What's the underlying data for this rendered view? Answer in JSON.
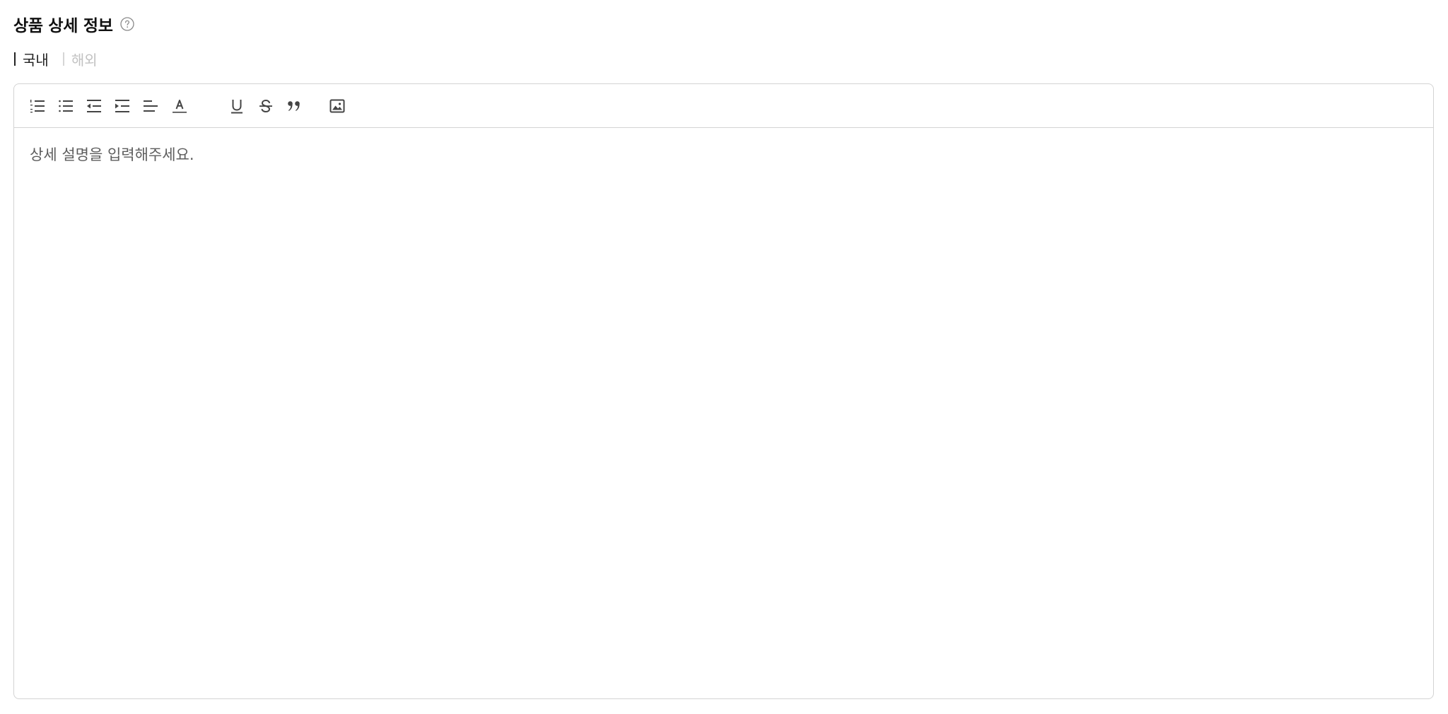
{
  "section": {
    "title": "상품 상세 정보",
    "help_icon": "question-circle-icon"
  },
  "tabs": [
    {
      "label": "국내",
      "active": true
    },
    {
      "label": "해외",
      "active": false
    }
  ],
  "toolbar": {
    "tools": [
      {
        "name": "ordered-list",
        "icon": "ordered-list-icon"
      },
      {
        "name": "bullet-list",
        "icon": "bullet-list-icon"
      },
      {
        "name": "outdent",
        "icon": "outdent-icon"
      },
      {
        "name": "indent",
        "icon": "indent-icon"
      },
      {
        "name": "align-left",
        "icon": "align-left-icon"
      },
      {
        "name": "text-color",
        "icon": "text-color-icon"
      },
      {
        "name": "underline",
        "icon": "underline-icon"
      },
      {
        "name": "strikethrough",
        "icon": "strikethrough-icon"
      },
      {
        "name": "blockquote",
        "icon": "quote-icon"
      },
      {
        "name": "image",
        "icon": "image-icon"
      }
    ]
  },
  "editor": {
    "placeholder": "상세 설명을 입력해주세요."
  },
  "colors": {
    "border": "#d3d3d3",
    "icon": "#444444",
    "tab_active": "#222222",
    "tab_inactive": "#c2c2c2",
    "placeholder": "#5d5d5d"
  }
}
